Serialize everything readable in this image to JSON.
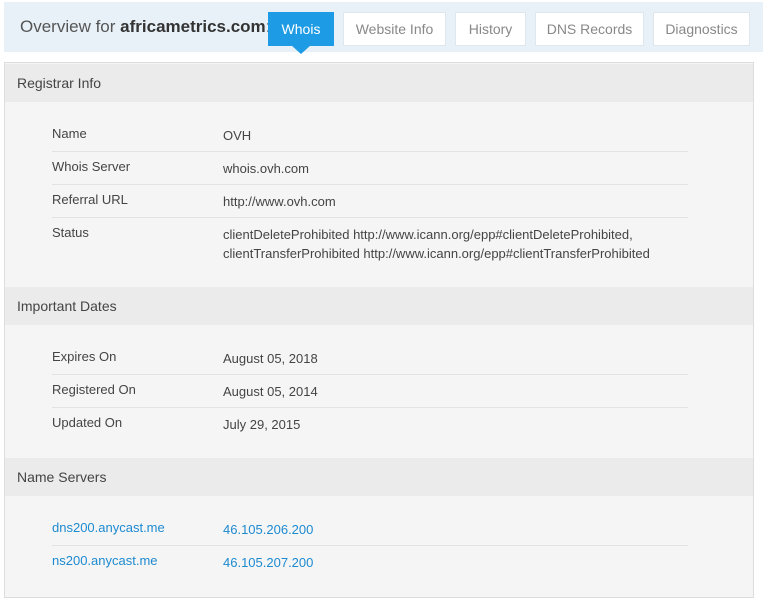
{
  "header": {
    "overview_prefix": "Overview for",
    "domain": "africametrics.com",
    "overview_suffix": ":",
    "tabs": [
      {
        "label": "Whois",
        "active": true
      },
      {
        "label": "Website Info",
        "active": false
      },
      {
        "label": "History",
        "active": false
      },
      {
        "label": "DNS Records",
        "active": false
      },
      {
        "label": "Diagnostics",
        "active": false
      }
    ]
  },
  "registrar": {
    "title": "Registrar Info",
    "rows": [
      {
        "key": "Name",
        "value": "OVH"
      },
      {
        "key": "Whois Server",
        "value": "whois.ovh.com"
      },
      {
        "key": "Referral URL",
        "value": "http://www.ovh.com"
      },
      {
        "key": "Status",
        "value_line1": "clientDeleteProhibited http://www.icann.org/epp#clientDeleteProhibited,",
        "value_line2": "clientTransferProhibited http://www.icann.org/epp#clientTransferProhibited"
      }
    ]
  },
  "dates": {
    "title": "Important Dates",
    "rows": [
      {
        "key": "Expires On",
        "value": "August 05, 2018"
      },
      {
        "key": "Registered On",
        "value": "August 05, 2014"
      },
      {
        "key": "Updated On",
        "value": "July 29, 2015"
      }
    ]
  },
  "nameservers": {
    "title": "Name Servers",
    "rows": [
      {
        "host": "dns200.anycast.me",
        "ip": "46.105.206.200"
      },
      {
        "host": "ns200.anycast.me",
        "ip": "46.105.207.200"
      }
    ]
  },
  "colors": {
    "accent": "#1d9ce5",
    "link": "#1d8ad0",
    "section_header_bg": "#ebebeb",
    "panel_bg": "#f5f5f5"
  }
}
